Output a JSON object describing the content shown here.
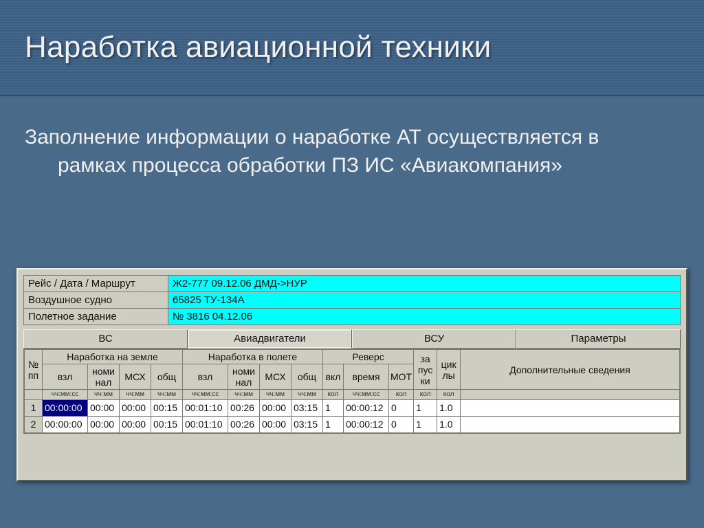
{
  "slide": {
    "title": "Наработка авиационной техники",
    "body": "Заполнение информации о наработке АТ осуществляется в рамках процесса обработки ПЗ ИС «Авиакомпания»"
  },
  "info": {
    "route_label": "Рейс / Дата / Маршрут",
    "route_value": "Ж2-777 09.12.06 ДМД->НУР",
    "aircraft_label": "Воздушное судно",
    "aircraft_value": "65825 ТУ-134А",
    "task_label": "Полетное задание",
    "task_value": "№ 3816 04.12.06"
  },
  "tabs": {
    "items": [
      "ВС",
      "Авиадвигатели",
      "ВСУ",
      "Параметры"
    ],
    "active_index": 1
  },
  "grid": {
    "group_headers": {
      "num": "№ пп",
      "ground": "Наработка на земле",
      "flight": "Наработка в полете",
      "reverse": "Реверс",
      "starts": "за пус ки",
      "cycles": "цик лы",
      "addinfo": "Дополнительные сведения"
    },
    "sub": {
      "vzl": "взл",
      "nominal": "номи нал",
      "msh": "МСХ",
      "total": "общ",
      "vkl": "вкл",
      "time": "время",
      "mot": "МОТ"
    },
    "fmt": {
      "hhmmss": "чч:мм:сс",
      "hhmm": "чч:мм",
      "count": "кол"
    },
    "rows": [
      {
        "num": "1",
        "g_vzl": "00:00:00",
        "g_nom": "00:00",
        "g_msh": "00:00",
        "g_tot": "00:15",
        "f_vzl": "00:01:10",
        "f_nom": "00:26",
        "f_msh": "00:00",
        "f_tot": "03:15",
        "r_vkl": "1",
        "r_time": "00:00:12",
        "r_mot": "0",
        "starts": "1",
        "cycles": "1.0",
        "extra": ""
      },
      {
        "num": "2",
        "g_vzl": "00:00:00",
        "g_nom": "00:00",
        "g_msh": "00:00",
        "g_tot": "00:15",
        "f_vzl": "00:01:10",
        "f_nom": "00:26",
        "f_msh": "00:00",
        "f_tot": "03:15",
        "r_vkl": "1",
        "r_time": "00:00:12",
        "r_mot": "0",
        "starts": "1",
        "cycles": "1.0",
        "extra": ""
      }
    ]
  }
}
